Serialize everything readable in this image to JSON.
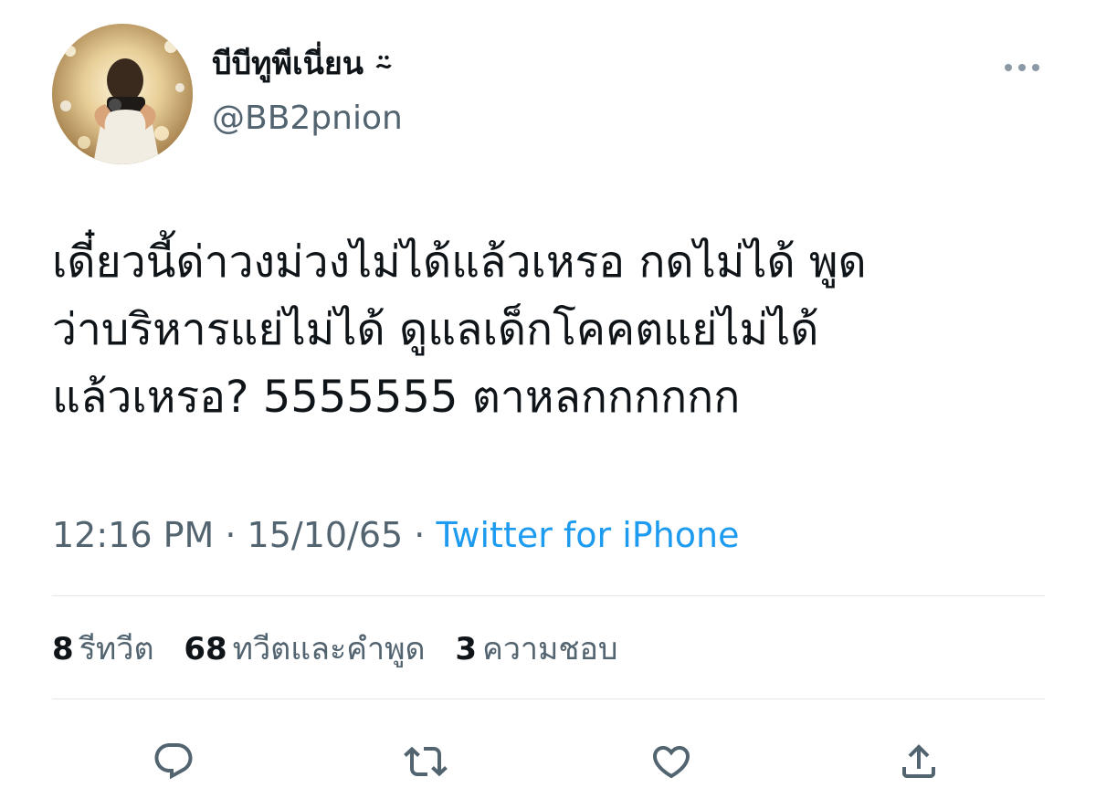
{
  "author": {
    "display_name": "บีบีทูพีเนี่ยน ⍨",
    "handle": "@BB2pnion",
    "avatar_icon": "user-avatar-photo"
  },
  "tweet": {
    "text": "เดี๋ยวนี้ด่าวงม่วงไม่ได้แล้วเหรอ กดไม่ได้ พูด\nว่าบริหารแย่ไม่ได้ ดูแลเด็กโคคตแย่ไม่ได้\nแล้วเหรอ? 5555555 ตาหลกกกกกก",
    "time": "12:16 PM",
    "date": "15/10/65",
    "separator": " · ",
    "source": "Twitter for iPhone"
  },
  "stats": {
    "retweets_count": "8",
    "retweets_label": "รีทวีต",
    "quotes_count": "68",
    "quotes_label": "ทวีตและคำพูด",
    "likes_count": "3",
    "likes_label": "ความชอบ"
  },
  "actions": {
    "reply_icon": "reply-icon",
    "retweet_icon": "retweet-icon",
    "like_icon": "heart-icon",
    "share_icon": "share-icon"
  },
  "colors": {
    "text": "#0f1419",
    "secondary": "#536471",
    "accent": "#1d9bf0",
    "divider": "#e3e7ea"
  }
}
